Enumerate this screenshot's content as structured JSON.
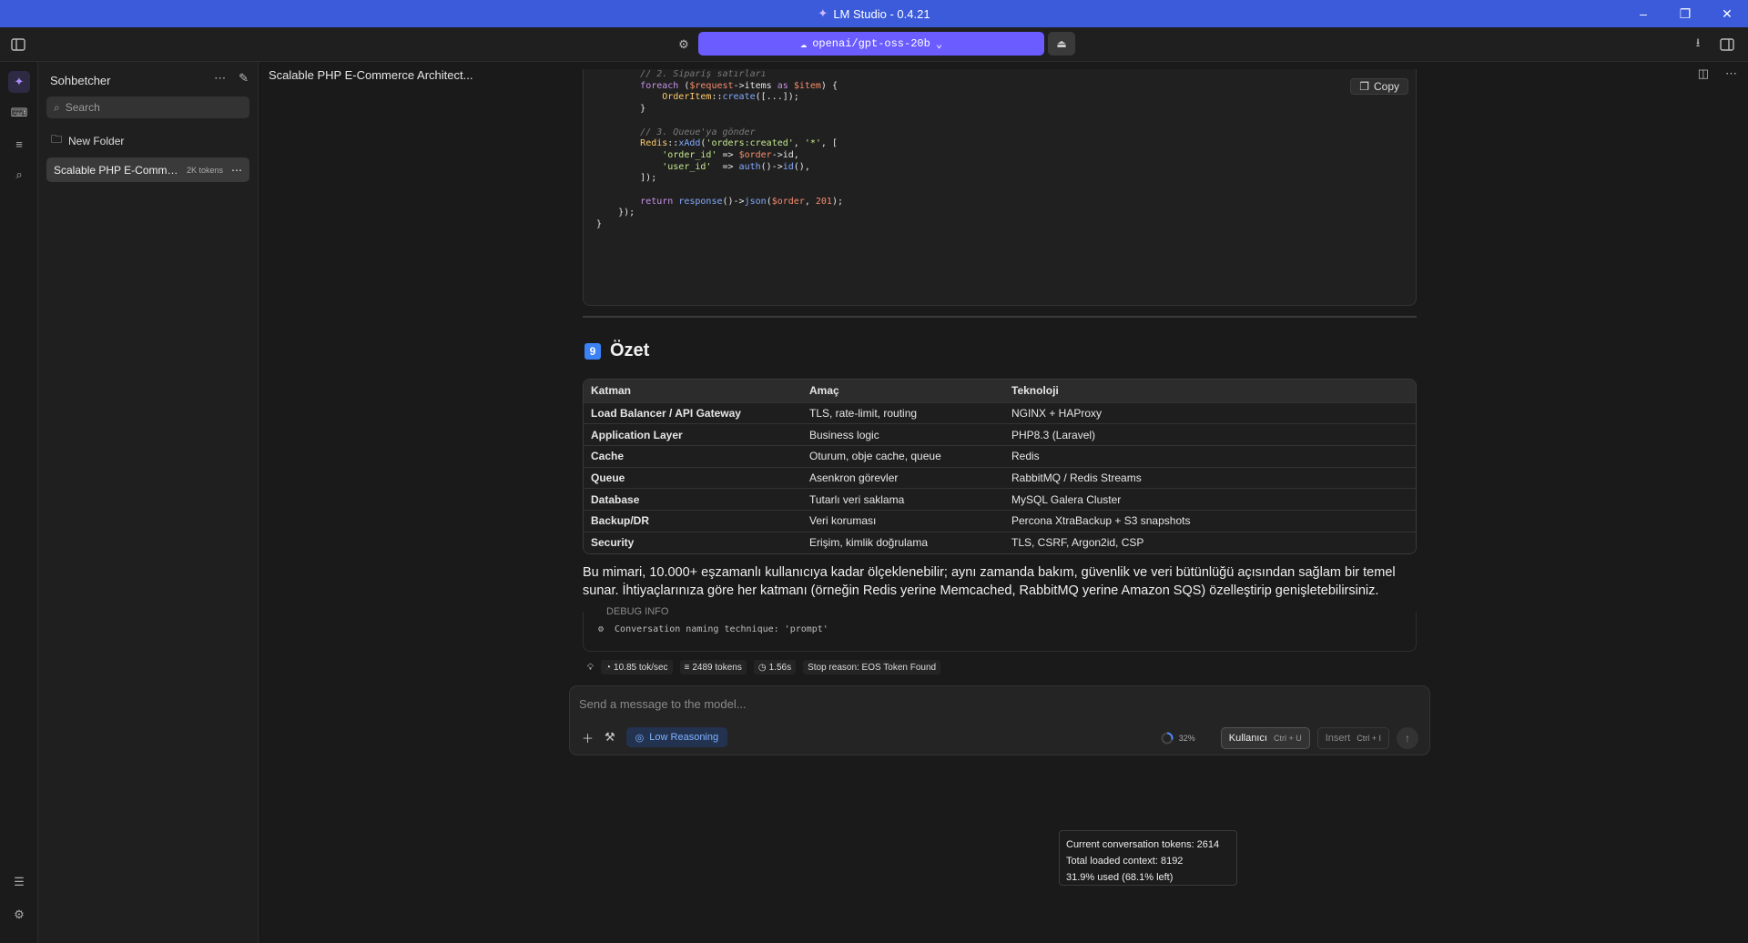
{
  "window": {
    "title": "LM Studio - 0.4.21"
  },
  "toolbar": {
    "model": "openai/gpt-oss-20b"
  },
  "sidebar": {
    "title": "Sohbetcher",
    "search_placeholder": "Search",
    "new_folder": "New Folder",
    "chats": [
      {
        "name": "Scalable PHP E-Comme...",
        "tokens": "2K tokens"
      }
    ]
  },
  "chat": {
    "title": "Scalable PHP E-Commerce Architect...",
    "code": {
      "copy_label": "Copy",
      "line1": "// 2. Sipariş satırları",
      "line9": "// 3. Queue'ya gönder"
    },
    "section": {
      "number": "9",
      "title": "Özet"
    },
    "table": {
      "headers": [
        "Katman",
        "Amaç",
        "Teknoloji"
      ],
      "rows": [
        [
          "Load Balancer / API Gateway",
          "TLS, rate-limit, routing",
          "NGINX + HAProxy"
        ],
        [
          "Application Layer",
          "Business logic",
          "PHP8.3 (Laravel)"
        ],
        [
          "Cache",
          "Oturum, obje cache, queue",
          "Redis"
        ],
        [
          "Queue",
          "Asenkron görevler",
          "RabbitMQ / Redis Streams"
        ],
        [
          "Database",
          "Tutarlı veri saklama",
          "MySQL Galera Cluster"
        ],
        [
          "Backup/DR",
          "Veri koruması",
          "Percona XtraBackup + S3 snapshots"
        ],
        [
          "Security",
          "Erişim, kimlik doğrulama",
          "TLS, CSRF, Argon2id, CSP"
        ]
      ]
    },
    "paragraph": "Bu mimari, 10.000+ eşzamanlı kullanıcıya kadar ölçeklenebilir; aynı zamanda bakım, güvenlik ve veri bütünlüğü açısından sağlam bir temel sunar. İhtiyaçlarınıza göre her katmanı (örneğin Redis yerine Memcached, RabbitMQ yerine Amazon SQS) özelleştirip genişletebilirsiniz.",
    "debug": {
      "label": "DEBUG INFO",
      "text": "Conversation naming technique: 'prompt'"
    },
    "stats": {
      "speed": "10.85 tok/sec",
      "tokens": "2489 tokens",
      "time": "1.56s",
      "stop": "Stop reason: EOS Token Found"
    }
  },
  "composer": {
    "placeholder": "Send a message to the model...",
    "reasoning": "Low Reasoning",
    "context_percent": "32%",
    "role": "Kullanıcı",
    "role_shortcut": "Ctrl + U",
    "insert": "Insert",
    "insert_shortcut": "Ctrl + I"
  },
  "tooltip": {
    "line1": "Current conversation tokens: 2614",
    "line2": "Total loaded context: 8192",
    "line3": "31.9% used (68.1% left)"
  },
  "colors": {
    "titlebar": "#3b5bdb",
    "model_pill": "#6a5cff",
    "accent_purple": "#a78bfa",
    "reasoning_blue": "#7fb2ff"
  }
}
